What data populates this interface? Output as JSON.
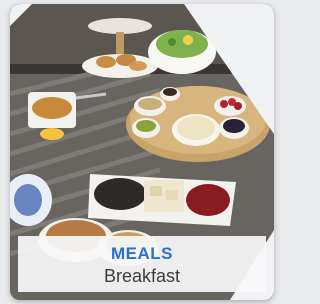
{
  "card": {
    "category": "MEALS",
    "title": "Breakfast"
  },
  "colors": {
    "category_text": "#2a6fd1",
    "title_text": "#3a3d40",
    "card_bg": "#f1f2f4"
  }
}
